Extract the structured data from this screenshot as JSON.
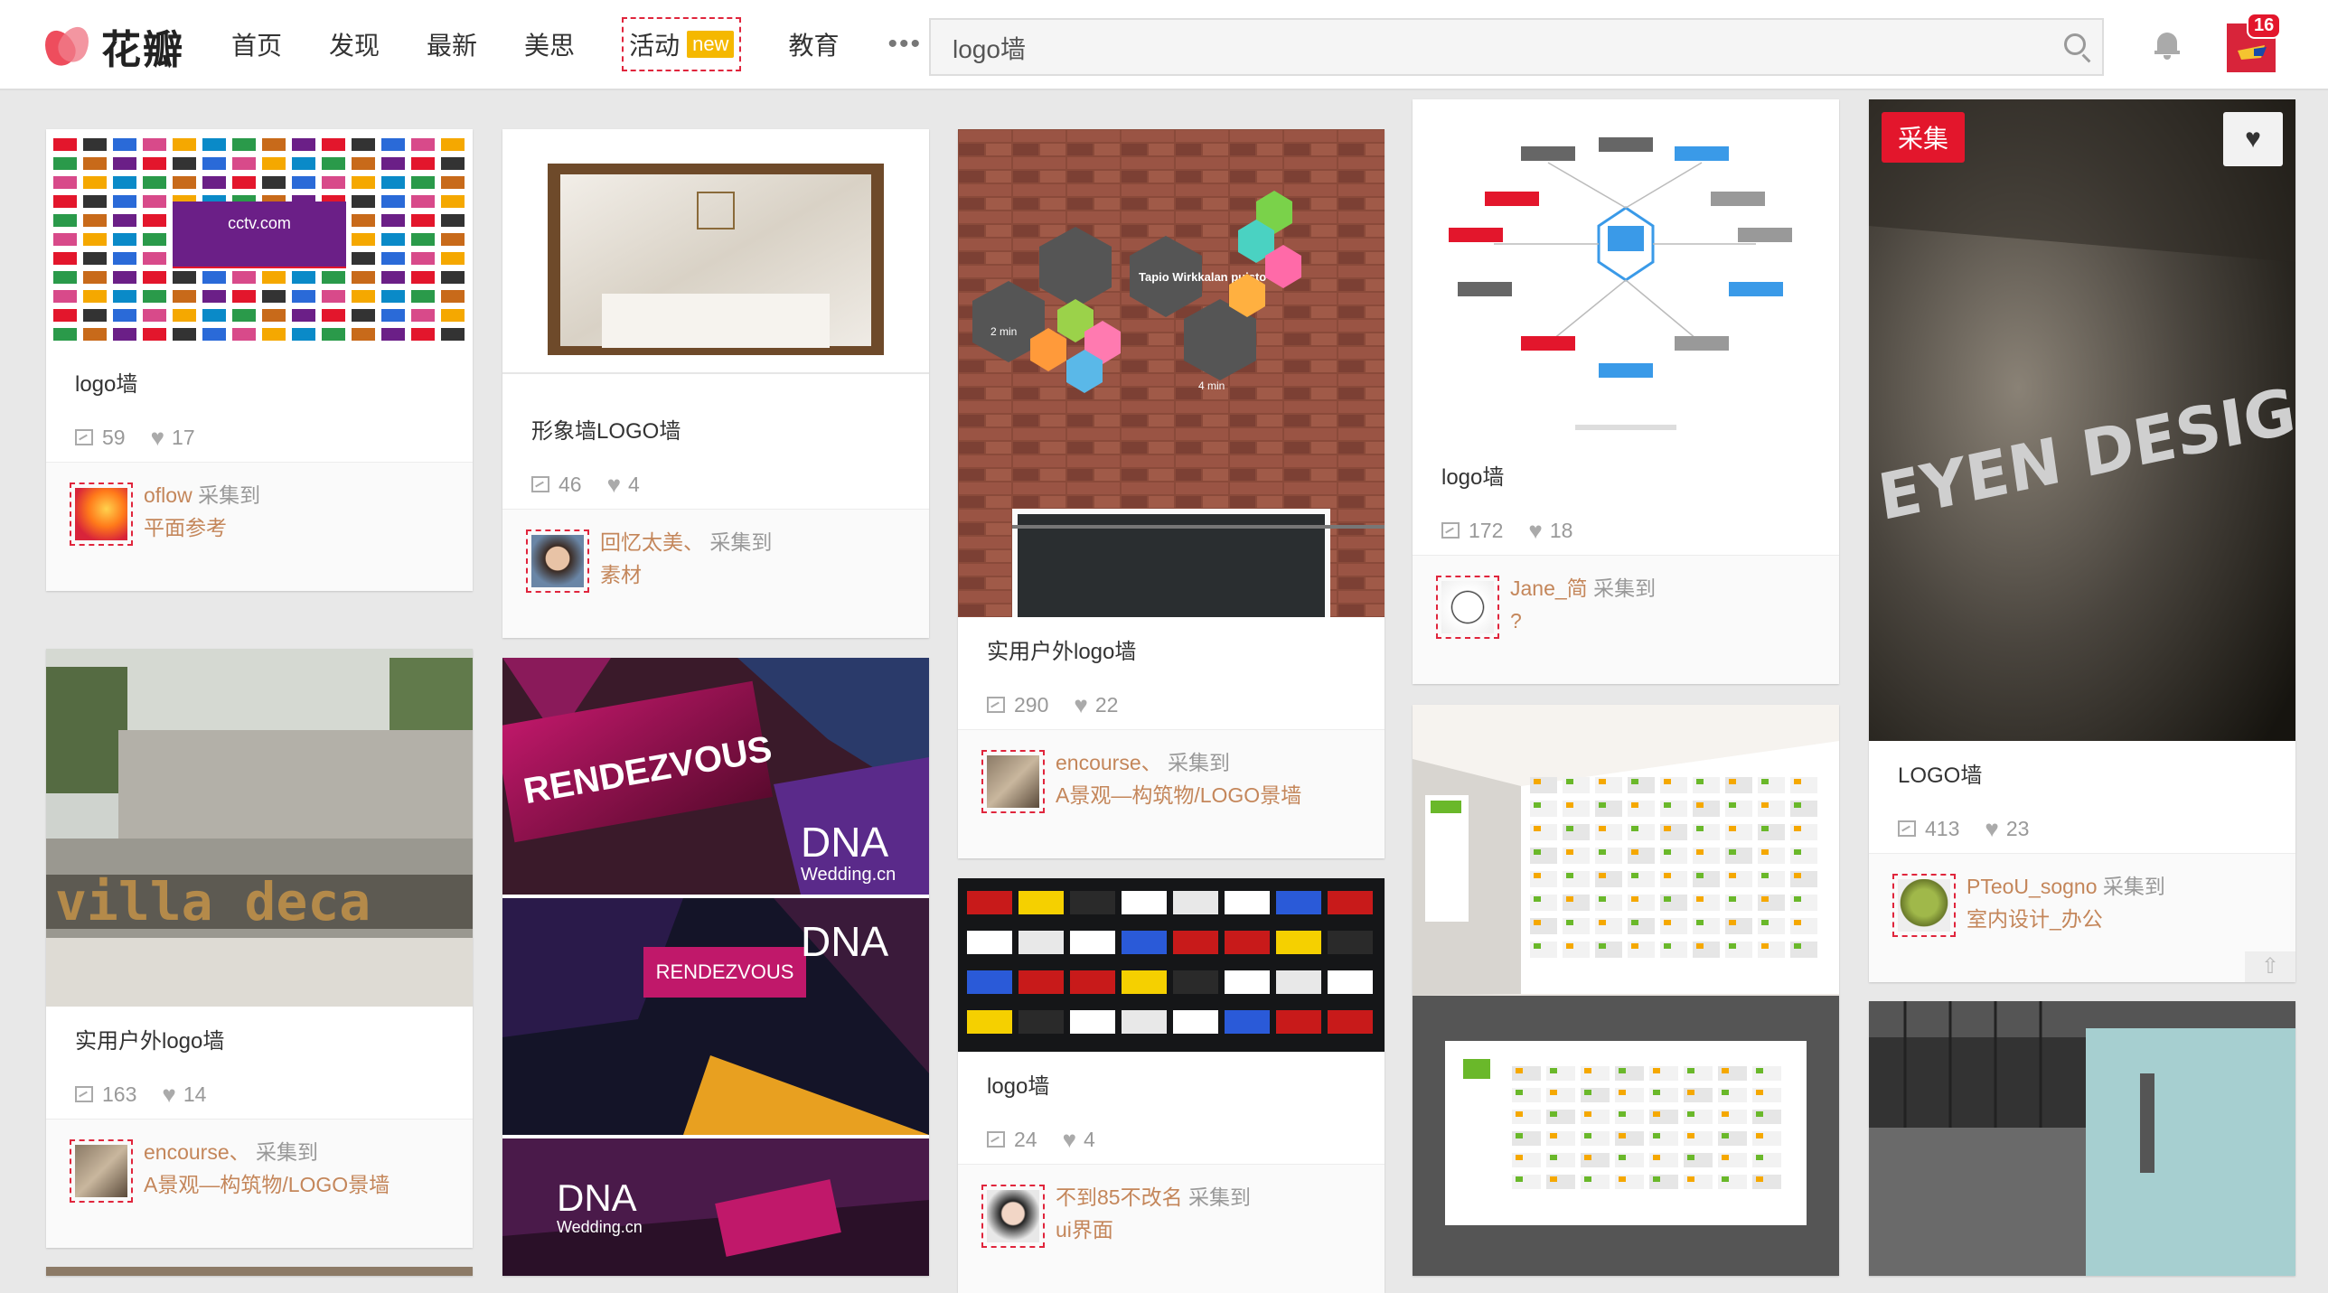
{
  "header": {
    "logo_text": "花瓣",
    "nav": [
      "首页",
      "发现",
      "最新",
      "美思",
      "活动",
      "教育"
    ],
    "nav_new_badge": "new",
    "more": "•••",
    "search_value": "logo墙",
    "notification_count": "16"
  },
  "colors": {
    "brand": "#e3162c",
    "link": "#c4865a"
  },
  "cards": [
    {
      "title": "logo墙",
      "repins": "59",
      "likes": "17",
      "user": "oflow",
      "action": "采集到",
      "board": "平面参考"
    },
    {
      "title": "实用户外logo墙",
      "repins": "163",
      "likes": "14",
      "user": "encourse、",
      "action": "采集到",
      "board": "A景观—构筑物/LOGO景墙"
    },
    {
      "title": "形象墙LOGO墙",
      "repins": "46",
      "likes": "4",
      "user": "回忆太美、",
      "action": "采集到",
      "board": "素材"
    },
    {
      "title": "实用户外logo墙",
      "repins": "290",
      "likes": "22",
      "user": "encourse、",
      "action": "采集到",
      "board": "A景观—构筑物/LOGO景墙"
    },
    {
      "title": "logo墙",
      "repins": "24",
      "likes": "4",
      "user": "不到85不改名",
      "action": "采集到",
      "board": "ui界面"
    },
    {
      "title": "logo墙",
      "repins": "172",
      "likes": "18",
      "user": "Jane_简",
      "action": "采集到",
      "board": "?"
    },
    {
      "title": "LOGO墙",
      "repins": "413",
      "likes": "23",
      "user": "PTeoU_sogno",
      "action": "采集到",
      "board": "室内设计_办公"
    }
  ],
  "overlay": {
    "pin_label": "采集",
    "like_icon": "♥",
    "scroll_top": "⇧"
  },
  "image_text": {
    "rendezvous": "RENDEZVOUS",
    "dna": "DNA",
    "dna_sub": "Wedding.cn",
    "villa": "villa deca",
    "tapio": "Tapio Wirkkalan puisto",
    "min2": "2 min",
    "min4": "4 min",
    "eyen": "EYEN DESIGN",
    "cctv": "cctv.com"
  }
}
